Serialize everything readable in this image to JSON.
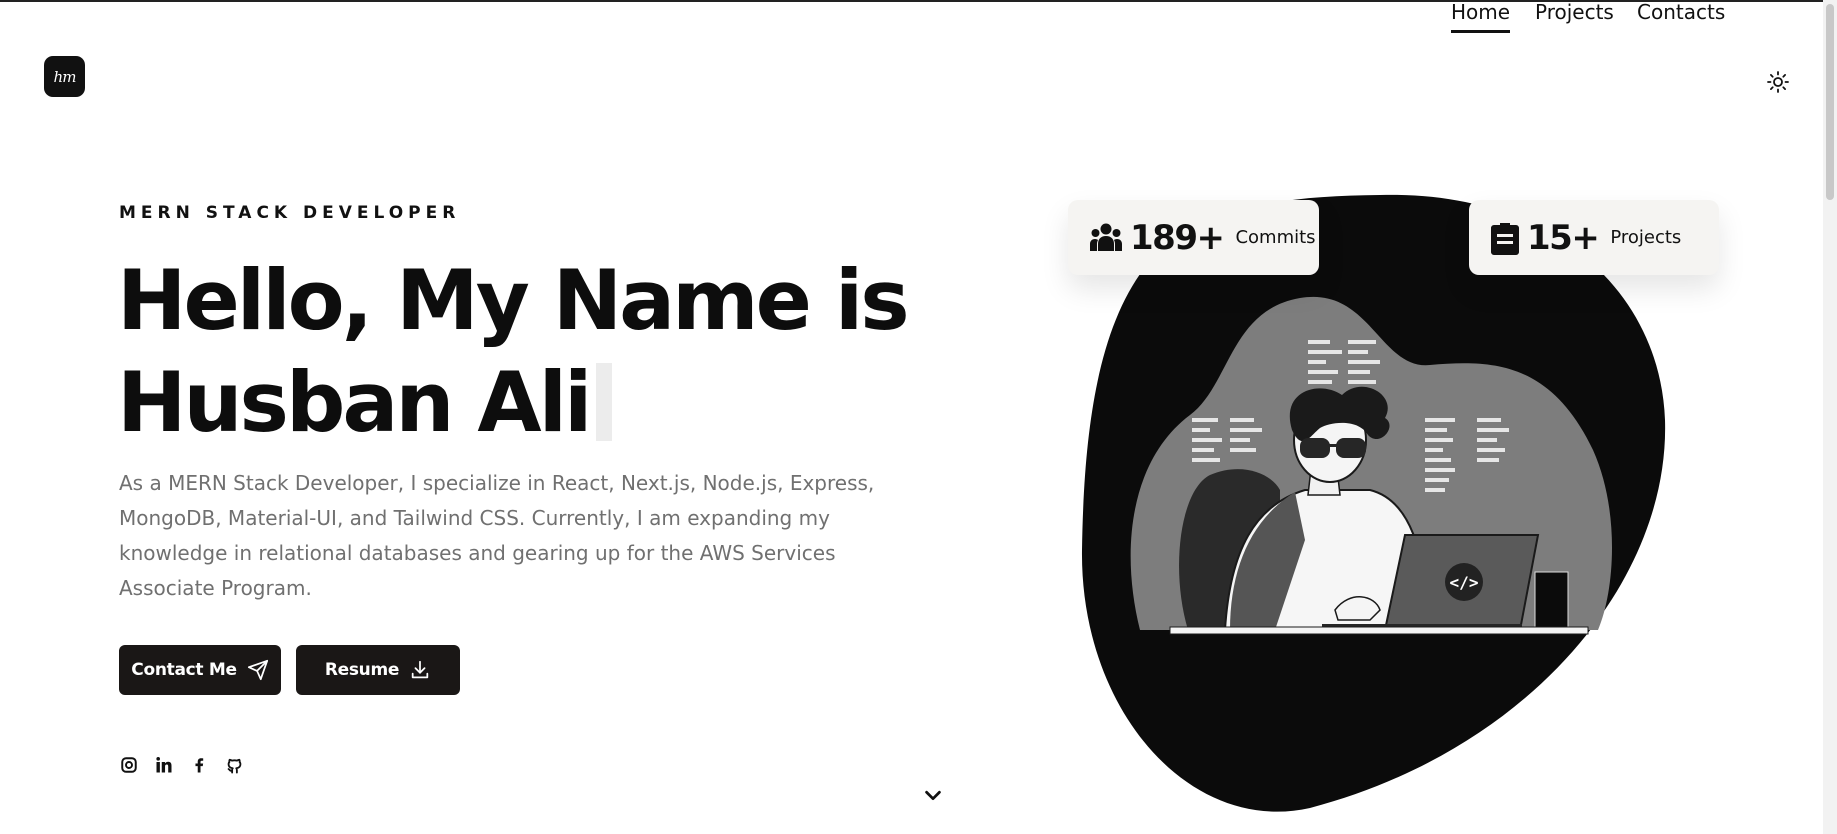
{
  "brand": {
    "logo_text": "hm"
  },
  "nav": {
    "items": [
      {
        "label": "Home",
        "active": true
      },
      {
        "label": "Projects",
        "active": false
      },
      {
        "label": "Contacts",
        "active": false
      }
    ],
    "theme_toggle_icon": "sun-icon"
  },
  "hero": {
    "kicker": "MERN STACK DEVELOPER",
    "headline_line1": "Hello, My Name is",
    "headline_line2": "Husban Ali",
    "intro": "As a MERN Stack Developer, I specialize in React, Next.js, Node.js, Express, MongoDB, Material-UI, and Tailwind CSS. Currently, I am expanding my knowledge in relational databases and gearing up for the AWS Services Associate Program.",
    "buttons": {
      "contact_label": "Contact Me",
      "contact_icon": "send-icon",
      "resume_label": "Resume",
      "resume_icon": "download-icon"
    },
    "socials": [
      "instagram-icon",
      "linkedin-icon",
      "facebook-icon",
      "github-icon"
    ],
    "scroll_icon": "chevron-down-icon"
  },
  "stats": {
    "commits": {
      "value": "189+",
      "label": "Commits",
      "icon": "users-icon"
    },
    "projects": {
      "value": "15+",
      "label": "Projects",
      "icon": "clipboard-icon"
    }
  },
  "illustration": {
    "laptop_text": "</>"
  },
  "colors": {
    "primary": "#1a1716",
    "text_muted": "#707070",
    "card_bg": "#f5f4f2"
  }
}
